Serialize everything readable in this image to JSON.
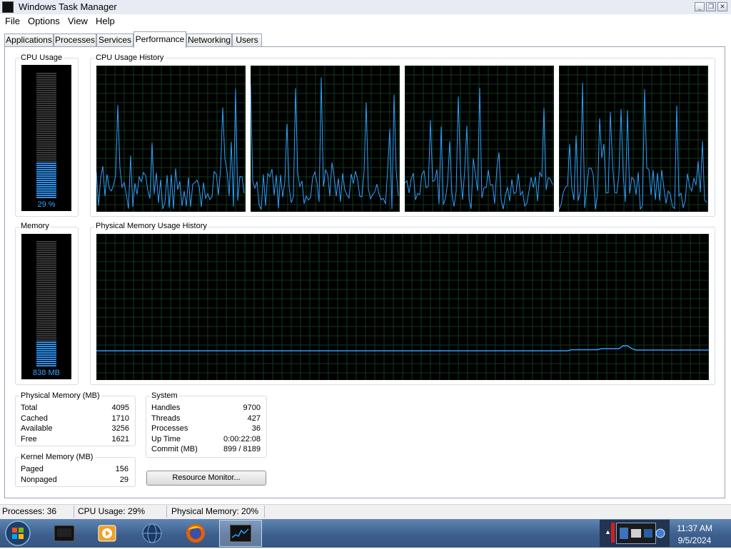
{
  "window": {
    "title": "Windows Task Manager",
    "controls": {
      "minimize": "_",
      "restore": "❐",
      "close": "✕"
    }
  },
  "menu": [
    "File",
    "Options",
    "View",
    "Help"
  ],
  "tabs": [
    "Applications",
    "Processes",
    "Services",
    "Performance",
    "Networking",
    "Users"
  ],
  "active_tab": "Performance",
  "cpu": {
    "label": "CPU Usage",
    "percent_text": "29 %",
    "percent": 29,
    "history_label": "CPU Usage History"
  },
  "memory": {
    "label": "Memory",
    "value_text": "838 MB",
    "fraction": 0.2,
    "history_label": "Physical Memory Usage History"
  },
  "physical_memory": {
    "title": "Physical Memory (MB)",
    "rows": [
      {
        "label": "Total",
        "value": "4095"
      },
      {
        "label": "Cached",
        "value": "1710"
      },
      {
        "label": "Available",
        "value": "3256"
      },
      {
        "label": "Free",
        "value": "1621"
      }
    ]
  },
  "kernel_memory": {
    "title": "Kernel Memory (MB)",
    "rows": [
      {
        "label": "Paged",
        "value": "156"
      },
      {
        "label": "Nonpaged",
        "value": "29"
      }
    ]
  },
  "system": {
    "title": "System",
    "rows": [
      {
        "label": "Handles",
        "value": "9700"
      },
      {
        "label": "Threads",
        "value": "427"
      },
      {
        "label": "Processes",
        "value": "36"
      },
      {
        "label": "Up Time",
        "value": "0:00:22:08"
      },
      {
        "label": "Commit (MB)",
        "value": "899 / 8189"
      }
    ]
  },
  "resource_monitor_label": "Resource Monitor...",
  "status": {
    "processes": "Processes: 36",
    "cpu": "CPU Usage: 29%",
    "memory": "Physical Memory: 20%"
  },
  "taskbar": {
    "apps": [
      "start-orb-icon",
      "task-manager-icon",
      "media-player-icon",
      "network-globe-icon",
      "firefox-icon",
      "performance-graph-icon"
    ],
    "time": "11:37 AM",
    "date": "9/5/2024"
  },
  "colors": {
    "graph_line": "#2ea0ff",
    "graph_grid": "#0f3a1e",
    "meter_on": "#2f8fe8",
    "meter_off": "#3a3a3a"
  }
}
